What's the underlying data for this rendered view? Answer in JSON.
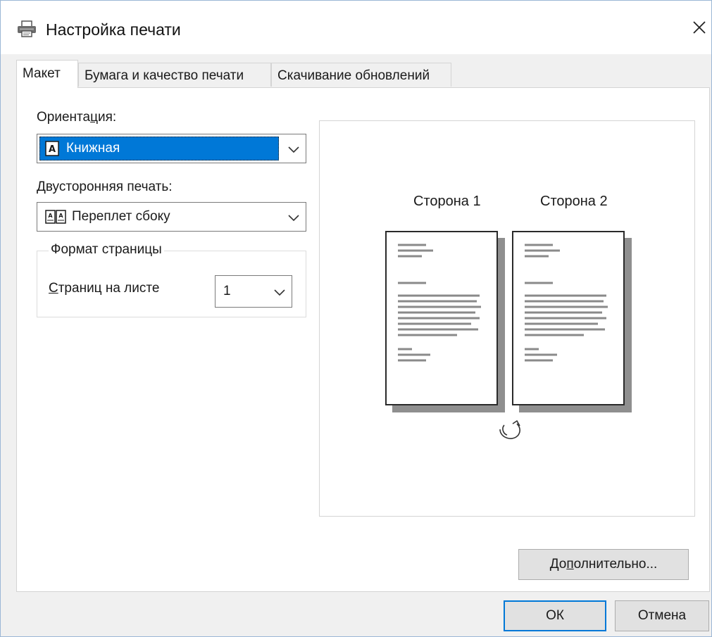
{
  "window": {
    "title": "Настройка печати",
    "icons": {
      "app": "printer-icon",
      "close": "close-icon"
    }
  },
  "tabs": [
    {
      "label": "Макет",
      "active": true
    },
    {
      "label": "Бумага и качество печати",
      "active": false
    },
    {
      "label": "Скачивание обновлений",
      "active": false
    }
  ],
  "layout_tab": {
    "orientation": {
      "label_pre": "Ориента",
      "label_mnemonic": "ц",
      "label_post": "ия:",
      "value": "Книжная",
      "icon": "portrait-page-icon"
    },
    "duplex": {
      "label_mnemonic": "Д",
      "label_post": "вусторонняя печать:",
      "value": "Переплет сбоку",
      "icon": "book-binding-icon"
    },
    "page_format": {
      "title": "Формат страницы",
      "pages_per_sheet": {
        "label_mnemonic": "С",
        "label_post": "траниц на листе",
        "value": "1"
      }
    }
  },
  "preview": {
    "side1": "Сторона 1",
    "side2": "Сторона 2",
    "flip_icon": "flip-rotate-icon"
  },
  "buttons": {
    "advanced": {
      "pre": "До",
      "mnemonic": "п",
      "post": "олнительно..."
    },
    "ok": "ОК",
    "cancel": "Отмена"
  },
  "colors": {
    "selection": "#0078d7",
    "default_button_border": "#0078d7",
    "dialog_bg": "#f0f0f0"
  }
}
